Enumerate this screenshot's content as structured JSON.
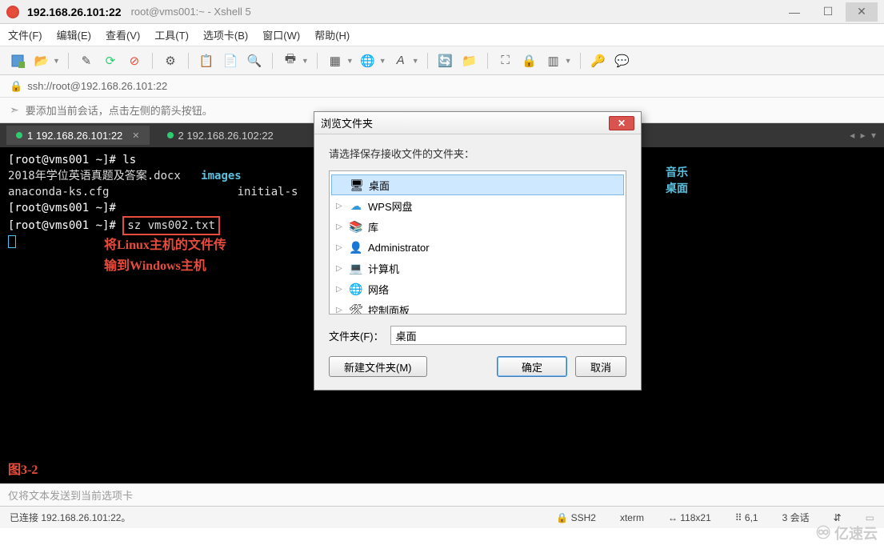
{
  "window": {
    "title_main": "192.168.26.101:22",
    "title_sub": "root@vms001:~ - Xshell 5"
  },
  "menu": {
    "file": "文件(F)",
    "edit": "编辑(E)",
    "view": "查看(V)",
    "tools": "工具(T)",
    "tabs": "选项卡(B)",
    "window": "窗口(W)",
    "help": "帮助(H)"
  },
  "address": "ssh://root@192.168.26.101:22",
  "hint": "要添加当前会话，点击左侧的箭头按钮。",
  "tabs": [
    {
      "label": "1 192.168.26.101:22",
      "active": true
    },
    {
      "label": "2 192.168.26.102:22",
      "active": false
    }
  ],
  "tabs_more": "◂ ▸ ▾",
  "terminal": {
    "lines": [
      "[root@vms001 ~]# ls",
      "2018年学位英语真题及答案.docx   images",
      "anaconda-ks.cfg                   initial-s",
      "[root@vms001 ~]#",
      "[root@vms001 ~]# "
    ],
    "sz_cmd": "sz vms002.txt",
    "far_col": [
      "音乐",
      "桌面"
    ],
    "annotation_l1": "将Linux主机的文件传",
    "annotation_l2": "输到Windows主机",
    "figure": "图3-2"
  },
  "dialog": {
    "title": "浏览文件夹",
    "instruction": "请选择保存接收文件的文件夹：",
    "tree": [
      {
        "icon": "🖥",
        "label": "桌面",
        "selected": true,
        "expandable": false
      },
      {
        "icon": "☁",
        "label": "WPS网盘",
        "selected": false,
        "expandable": true
      },
      {
        "icon": "📚",
        "label": "库",
        "selected": false,
        "expandable": true
      },
      {
        "icon": "👤",
        "label": "Administrator",
        "selected": false,
        "expandable": true
      },
      {
        "icon": "💻",
        "label": "计算机",
        "selected": false,
        "expandable": true
      },
      {
        "icon": "🌐",
        "label": "网络",
        "selected": false,
        "expandable": true
      },
      {
        "icon": "🛠",
        "label": "控制面板",
        "selected": false,
        "expandable": true
      }
    ],
    "folder_label": "文件夹(F)：",
    "folder_value": "桌面",
    "btn_new": "新建文件夹(M)",
    "btn_ok": "确定",
    "btn_cancel": "取消"
  },
  "sendbar": "仅将文本发送到当前选项卡",
  "status": {
    "conn": "已连接 192.168.26.101:22。",
    "ssh": "SSH2",
    "term": "xterm",
    "size": "118x21",
    "pos": "6,1",
    "sess": "3 会话"
  },
  "watermark": "亿速云"
}
